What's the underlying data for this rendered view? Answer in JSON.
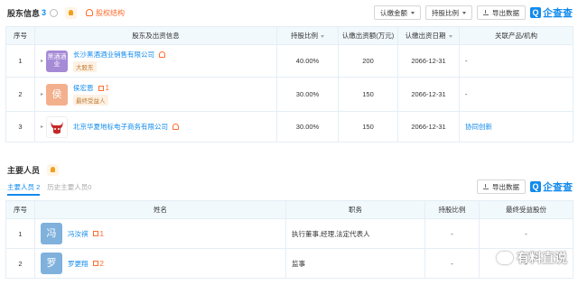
{
  "shareholders": {
    "title": "股东信息",
    "count": "3",
    "equity_link": "股权结构",
    "toolbar": {
      "sort_amount": "认缴金额",
      "sort_ratio": "持股比例",
      "export": "导出数据",
      "brand": "企查查",
      "brand_q": "Q"
    },
    "headers": [
      "序号",
      "股东及出资信息",
      "持股比例",
      "认缴出资额(万元)",
      "认缴出资日期",
      "关联产品/机构"
    ],
    "rows": [
      {
        "no": "1",
        "logo": "黑酒酒业",
        "name": "长沙黑酒酒业销售有限公司",
        "tag": "大股东",
        "ratio": "40.00%",
        "amount": "200",
        "date": "2066-12-31",
        "related": "-"
      },
      {
        "no": "2",
        "logo": "侯",
        "name": "侯宏恩",
        "count": "1",
        "tag": "最终受益人",
        "ratio": "30.00%",
        "amount": "150",
        "date": "2066-12-31",
        "related": "-"
      },
      {
        "no": "3",
        "logo": "",
        "name": "北京华夏地标电子商务有限公司",
        "tag": "",
        "ratio": "30.00%",
        "amount": "150",
        "date": "2066-12-31",
        "related": "协同创新"
      }
    ]
  },
  "personnel": {
    "title": "主要人员",
    "tabs": {
      "active_label": "主要人员",
      "active_count": "2",
      "inactive_label": "历史主要人员",
      "inactive_count": "0"
    },
    "toolbar": {
      "export": "导出数据",
      "brand": "企查查",
      "brand_q": "Q"
    },
    "headers": [
      "序号",
      "姓名",
      "职务",
      "持股比例",
      "最终受益股份"
    ],
    "rows": [
      {
        "no": "1",
        "avatar": "冯",
        "name": "冯汝祺",
        "count": "1",
        "role": "执行董事,经理,法定代表人",
        "ratio": "-",
        "benefit": "-"
      },
      {
        "no": "2",
        "avatar": "罗",
        "name": "罗更翔",
        "count": "2",
        "role": "监事",
        "ratio": "-",
        "benefit": "-"
      }
    ]
  },
  "watermark": {
    "text": "有料直说"
  },
  "colors": {
    "accent": "#128bed",
    "orange": "#ff6b2c",
    "header_bg": "#f2f9fc",
    "border": "#e4eef6"
  }
}
